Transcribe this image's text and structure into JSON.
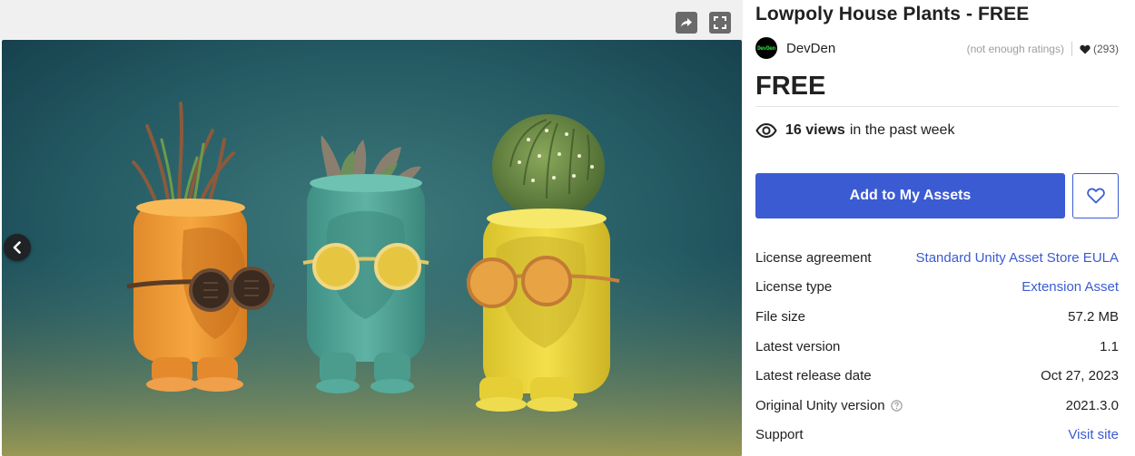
{
  "gallery": {
    "share_icon": "share-arrow-icon",
    "fullscreen_icon": "fullscreen-icon",
    "prev_icon": "chevron-left-icon"
  },
  "product": {
    "title": "Lowpoly House Plants - FREE",
    "publisher": {
      "avatar_text": "DevDen",
      "name": "DevDen"
    },
    "rating_text": "(not enough ratings)",
    "favorites_count": "(293)",
    "price": "FREE",
    "views": {
      "count": "16 views",
      "suffix": "in the past week"
    },
    "add_button_label": "Add to My Assets"
  },
  "details": [
    {
      "label": "License agreement",
      "value": "Standard Unity Asset Store EULA",
      "is_link": true
    },
    {
      "label": "License type",
      "value": "Extension Asset",
      "is_link": true
    },
    {
      "label": "File size",
      "value": "57.2 MB",
      "is_link": false
    },
    {
      "label": "Latest version",
      "value": "1.1",
      "is_link": false
    },
    {
      "label": "Latest release date",
      "value": "Oct 27, 2023",
      "is_link": false
    },
    {
      "label": "Original Unity version",
      "value": "2021.3.0",
      "is_link": false,
      "has_help": true
    },
    {
      "label": "Support",
      "value": "Visit site",
      "is_link": true
    }
  ],
  "colors": {
    "accent": "#3b5bd2",
    "text": "#212121",
    "muted": "#9e9e9e"
  }
}
